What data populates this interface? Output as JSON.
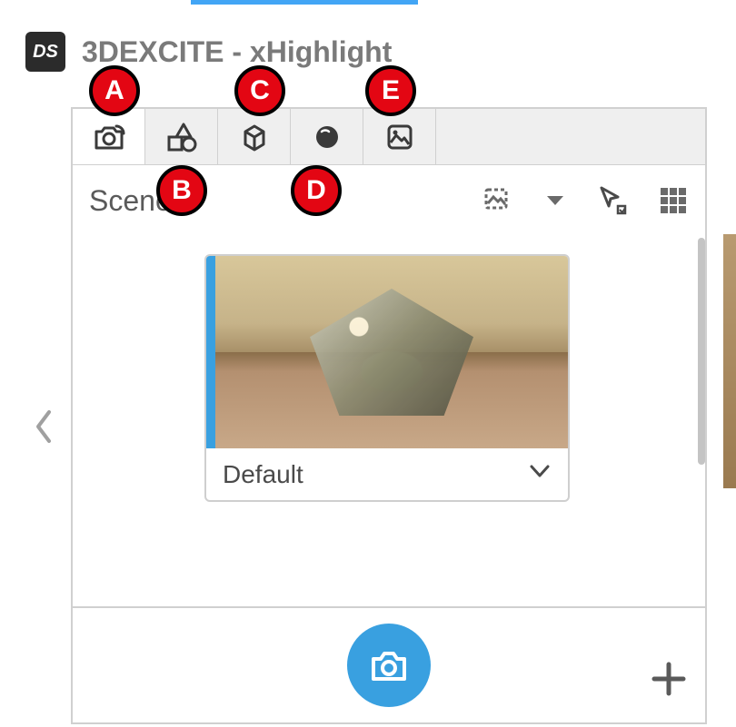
{
  "app": {
    "logo_text": "DS",
    "title": "3DEXCITE - xHighlight"
  },
  "tabs": [
    {
      "name": "scenes-tab",
      "icon": "camera-icon",
      "active": true
    },
    {
      "name": "shapes-tab",
      "icon": "shapes-icon",
      "active": false
    },
    {
      "name": "model-tab",
      "icon": "box-icon",
      "active": false
    },
    {
      "name": "material-tab",
      "icon": "sphere-icon",
      "active": false
    },
    {
      "name": "environment-tab",
      "icon": "environment-icon",
      "active": false
    }
  ],
  "section": {
    "title": "Scenes"
  },
  "scene_card": {
    "label": "Default"
  },
  "callouts": {
    "A": "A",
    "B": "B",
    "C": "C",
    "D": "D",
    "E": "E"
  }
}
